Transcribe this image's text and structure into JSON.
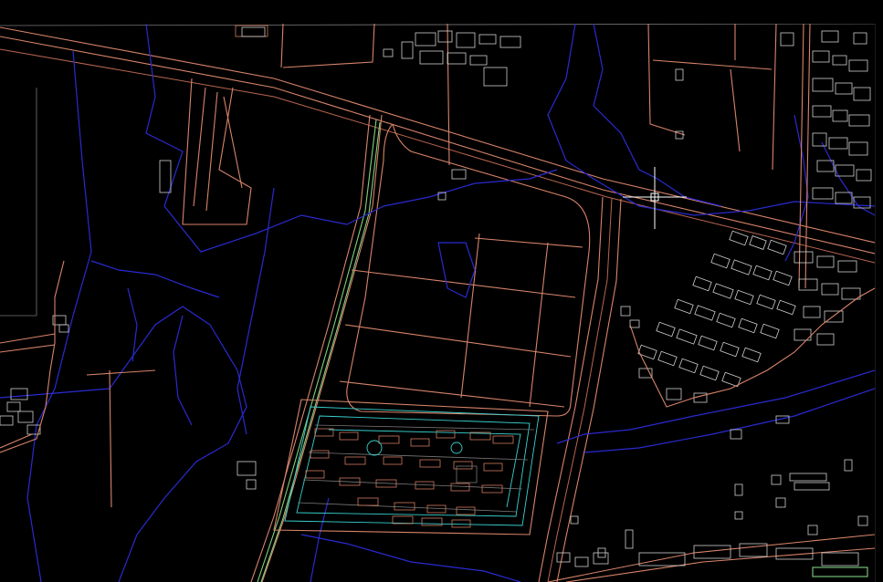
{
  "window": {
    "background": "#000000"
  },
  "colors": {
    "road": "#d8846a",
    "water": "#2a2ad0",
    "building": "#cfcfcf",
    "green_line": "#7fd07f",
    "cyan_line": "#3ad0d0",
    "crosshair": "#ffffff"
  },
  "cursor": {
    "type": "crosshair-pickbox-icon"
  }
}
